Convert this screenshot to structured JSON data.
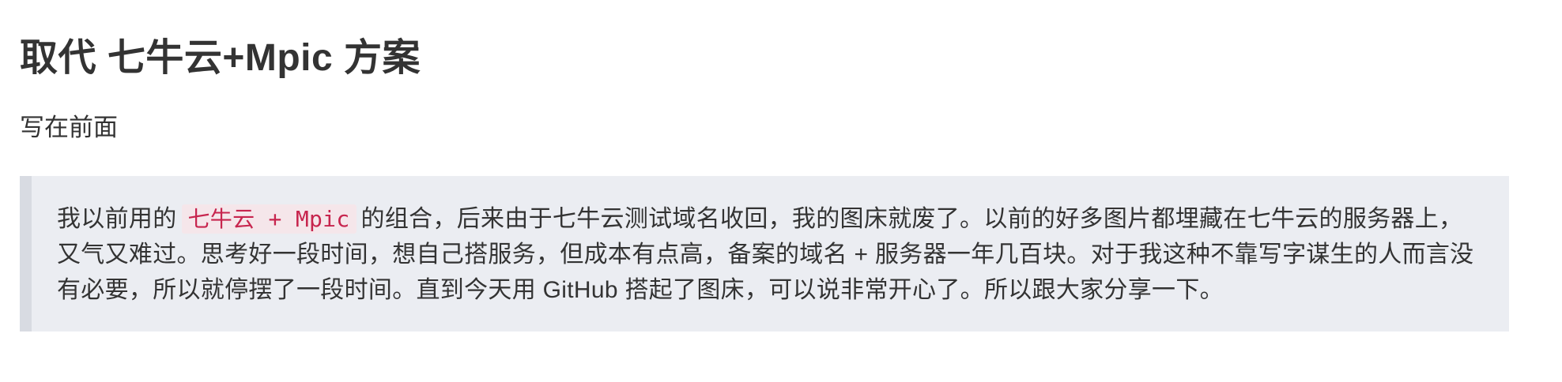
{
  "article": {
    "title": "取代 七牛云+Mpic 方案",
    "subtitle": "写在前面",
    "quote": {
      "text_before": "我以前用的",
      "code": "七牛云 + Mpic",
      "text_after": "的组合，后来由于七牛云测试域名收回，我的图床就废了。以前的好多图片都埋藏在七牛云的服务器上，又气又难过。思考好一段时间，想自己搭服务，但成本有点高，备案的域名 + 服务器一年几百块。对于我这种不靠写字谋生的人而言没有必要，所以就停摆了一段时间。直到今天用 GitHub 搭起了图床，可以说非常开心了。所以跟大家分享一下。"
    }
  }
}
